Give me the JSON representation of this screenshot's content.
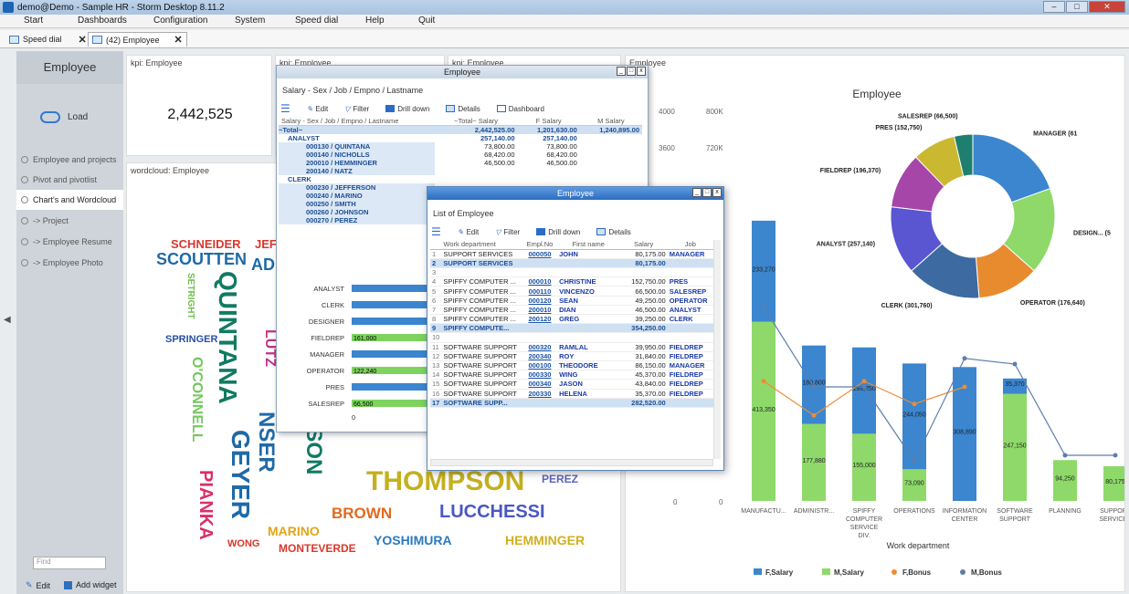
{
  "app": {
    "title": "demo@Demo - Sample HR - Storm Desktop 8.11.2"
  },
  "menu": [
    "Start",
    "Dashboards",
    "Configuration",
    "System",
    "Speed dial",
    "Help",
    "Quit"
  ],
  "tabs": [
    {
      "label": "Speed dial"
    },
    {
      "label": "(42) Employee"
    }
  ],
  "sidebar": {
    "title": "Employee",
    "load": "Load",
    "items": [
      "Employee and projects",
      "Pivot and pivotlist",
      "Chart's and Wordcloud",
      "-> Project",
      "-> Employee Resume",
      "-> Employee Photo"
    ],
    "active_index": 2,
    "find_placeholder": "Find",
    "edit": "Edit",
    "add_widget": "Add widget"
  },
  "kpi": [
    {
      "title": "kpi: Employee",
      "value": "2,442,525"
    },
    {
      "title": "kpi: Employee"
    },
    {
      "title": "kpi: Employee"
    }
  ],
  "wordcloud": {
    "title": "wordcloud: Employee",
    "words": [
      {
        "t": "SCHNEIDER",
        "c": "#d8382c",
        "s": 13
      },
      {
        "t": "JEF",
        "c": "#d8382c",
        "s": 13
      },
      {
        "t": "SCOUTTEN",
        "c": "#1f6aa7",
        "s": 18
      },
      {
        "t": "AD",
        "c": "#1f6aa7",
        "s": 18
      },
      {
        "t": "SETRIGHT",
        "c": "#6cc04a",
        "s": 10,
        "v": true
      },
      {
        "t": "QUINTANA",
        "c": "#127a63",
        "s": 28,
        "v": true
      },
      {
        "t": "SPRINGER",
        "c": "#2a4fa3",
        "s": 11
      },
      {
        "t": "LUTZ",
        "c": "#c53086",
        "s": 16,
        "v": true
      },
      {
        "t": "O'CONNELL",
        "c": "#76c860",
        "s": 16,
        "v": true
      },
      {
        "t": "GEYER",
        "c": "#1f6aa7",
        "s": 28,
        "v": true
      },
      {
        "t": "PIANKA",
        "c": "#d8306b",
        "s": 20,
        "v": true
      },
      {
        "t": "NSER",
        "c": "#1f6aa7",
        "s": 24,
        "v": true
      },
      {
        "t": "RSON",
        "c": "#127a63",
        "s": 24,
        "v": true
      },
      {
        "t": "THOMPSON",
        "c": "#c4b020",
        "s": 30
      },
      {
        "t": "PEREZ",
        "c": "#5a63c2",
        "s": 12
      },
      {
        "t": "BROWN",
        "c": "#e06a1f",
        "s": 17
      },
      {
        "t": "LUCCHESSI",
        "c": "#4a58c2",
        "s": 20
      },
      {
        "t": "MARINO",
        "c": "#e3a415",
        "s": 14
      },
      {
        "t": "WONG",
        "c": "#d8382c",
        "s": 11
      },
      {
        "t": "MONTEVERDE",
        "c": "#d8382c",
        "s": 12
      },
      {
        "t": "YOSHIMURA",
        "c": "#2a7ac0",
        "s": 14
      },
      {
        "t": "HEMMINGER",
        "c": "#d0b020",
        "s": 14
      }
    ]
  },
  "pivot_window": {
    "title": "Employee",
    "subtitle": "Salary - Sex / Job / Empno / Lastname",
    "toolbar": [
      "Edit",
      "Filter",
      "Drill down",
      "Details",
      "Dashboard"
    ],
    "header": [
      "Salary - Sex / Job / Empno / Lastname",
      "~Total~ Salary",
      "F Salary",
      "M Salary"
    ],
    "rows": [
      {
        "label": "~Total~",
        "total": "2,442,525.00",
        "f": "1,201,630.00",
        "m": "1,240,895.00",
        "kind": "tot"
      },
      {
        "label": "ANALYST",
        "total": "257,140.00",
        "f": "257,140.00",
        "m": "",
        "kind": "grp"
      },
      {
        "label": "000130 / QUINTANA",
        "total": "73,800.00",
        "f": "73,800.00",
        "m": "",
        "kind": "row"
      },
      {
        "label": "000140 / NICHOLLS",
        "total": "68,420.00",
        "f": "68,420.00",
        "m": "",
        "kind": "row"
      },
      {
        "label": "200010 / HEMMINGER",
        "total": "46,500.00",
        "f": "46,500.00",
        "m": "",
        "kind": "row"
      },
      {
        "label": "200140 / NATZ",
        "total": "",
        "f": "",
        "m": "",
        "kind": "row"
      },
      {
        "label": "CLERK",
        "total": "",
        "f": "",
        "m": "",
        "kind": "grp"
      },
      {
        "label": "000230 / JEFFERSON",
        "total": "",
        "f": "",
        "m": "",
        "kind": "row"
      },
      {
        "label": "000240 / MARINO",
        "total": "",
        "f": "",
        "m": "",
        "kind": "row"
      },
      {
        "label": "000250 / SMITH",
        "total": "",
        "f": "",
        "m": "",
        "kind": "row"
      },
      {
        "label": "000260 / JOHNSON",
        "total": "",
        "f": "",
        "m": "",
        "kind": "row"
      },
      {
        "label": "000270 / PEREZ",
        "total": "",
        "f": "",
        "m": "",
        "kind": "row"
      }
    ],
    "minichart": {
      "categories": [
        "ANALYST",
        "CLERK",
        "DESIGNER",
        "FIELDREP",
        "MANAGER",
        "OPERATOR",
        "PRES",
        "SALESREP"
      ],
      "blue": [
        "257,140",
        "217,130",
        "341,",
        "",
        "332,8",
        "",
        "152,750",
        ""
      ],
      "green": [
        "",
        "",
        "",
        "161,000",
        "",
        "122,240",
        "",
        "66,500"
      ],
      "blue_v": [
        257140,
        217130,
        341000,
        35000,
        332800,
        15000,
        152750,
        0
      ],
      "green_v": [
        0,
        0,
        0,
        161000,
        0,
        122240,
        0,
        66500
      ],
      "axis": [
        "0",
        "100K"
      ]
    }
  },
  "list_window": {
    "title": "Employee",
    "subtitle": "List of Employee",
    "toolbar": [
      "Edit",
      "Filter",
      "Drill down",
      "Details"
    ],
    "header": [
      "Work department",
      "Empl.No",
      "First name",
      "Salary",
      "Job"
    ],
    "rows": [
      {
        "n": "1",
        "dept": "SUPPORT SERVICES",
        "emp": "000050",
        "fn": "JOHN",
        "sal": "80,175.00",
        "job": "MANAGER",
        "sum": false
      },
      {
        "n": "2",
        "dept": "SUPPORT SERVICES",
        "emp": "",
        "fn": "",
        "sal": "80,175.00",
        "job": "",
        "sum": true
      },
      {
        "n": "3",
        "dept": "",
        "emp": "",
        "fn": "",
        "sal": "",
        "job": "",
        "sum": false
      },
      {
        "n": "4",
        "dept": "SPIFFY COMPUTER ...",
        "emp": "000010",
        "fn": "CHRISTINE",
        "sal": "152,750.00",
        "job": "PRES",
        "sum": false
      },
      {
        "n": "5",
        "dept": "SPIFFY COMPUTER ...",
        "emp": "000110",
        "fn": "VINCENZO",
        "sal": "66,500.00",
        "job": "SALESREP",
        "sum": false
      },
      {
        "n": "6",
        "dept": "SPIFFY COMPUTER ...",
        "emp": "000120",
        "fn": "SEAN",
        "sal": "49,250.00",
        "job": "OPERATOR",
        "sum": false
      },
      {
        "n": "7",
        "dept": "SPIFFY COMPUTER ...",
        "emp": "200010",
        "fn": "DIAN",
        "sal": "46,500.00",
        "job": "ANALYST",
        "sum": false
      },
      {
        "n": "8",
        "dept": "SPIFFY COMPUTER ...",
        "emp": "200120",
        "fn": "GREG",
        "sal": "39,250.00",
        "job": "CLERK",
        "sum": false
      },
      {
        "n": "9",
        "dept": "SPIFFY COMPUTE...",
        "emp": "",
        "fn": "",
        "sal": "354,250.00",
        "job": "",
        "sum": true
      },
      {
        "n": "10",
        "dept": "",
        "emp": "",
        "fn": "",
        "sal": "",
        "job": "",
        "sum": false
      },
      {
        "n": "11",
        "dept": "SOFTWARE SUPPORT",
        "emp": "000320",
        "fn": "RAMLAL",
        "sal": "39,950.00",
        "job": "FIELDREP",
        "sum": false
      },
      {
        "n": "12",
        "dept": "SOFTWARE SUPPORT",
        "emp": "200340",
        "fn": "ROY",
        "sal": "31,840.00",
        "job": "FIELDREP",
        "sum": false
      },
      {
        "n": "13",
        "dept": "SOFTWARE SUPPORT",
        "emp": "000100",
        "fn": "THEODORE",
        "sal": "86,150.00",
        "job": "MANAGER",
        "sum": false
      },
      {
        "n": "14",
        "dept": "SOFTWARE SUPPORT",
        "emp": "000330",
        "fn": "WING",
        "sal": "45,370.00",
        "job": "FIELDREP",
        "sum": false
      },
      {
        "n": "15",
        "dept": "SOFTWARE SUPPORT",
        "emp": "000340",
        "fn": "JASON",
        "sal": "43,840.00",
        "job": "FIELDREP",
        "sum": false
      },
      {
        "n": "16",
        "dept": "SOFTWARE SUPPORT",
        "emp": "200330",
        "fn": "HELENA",
        "sal": "35,370.00",
        "job": "FIELDREP",
        "sum": false
      },
      {
        "n": "17",
        "dept": "SOFTWARE SUPP...",
        "emp": "",
        "fn": "",
        "sal": "282,520.00",
        "job": "",
        "sum": true
      }
    ]
  },
  "chart_panel": {
    "title": "Employee"
  },
  "chart_data": {
    "type": "bar",
    "title": "Employee",
    "xlabel": "Work department",
    "categories": [
      "MANUFACTU...",
      "ADMINISTR...",
      "SPIFFY COMPUTER SERVICE DIV.",
      "OPERATIONS",
      "INFORMATION CENTER",
      "SOFTWARE SUPPORT",
      "PLANNING",
      "SUPPORT SERVICES"
    ],
    "y_left_ticks": [
      "0",
      "3600"
    ],
    "y_right_ticks": [
      "0",
      "720K",
      "800K"
    ],
    "y_left_top": "4000",
    "series": [
      {
        "name": "F,Salary",
        "color": "#3b86cf",
        "values": [
          233270,
          180800,
          199250,
          244050,
          308890,
          35370,
          0,
          0
        ]
      },
      {
        "name": "M,Salary",
        "color": "#8ed96a",
        "values": [
          413350,
          177880,
          155000,
          73090,
          0,
          247150,
          94250,
          80175
        ]
      },
      {
        "name": "F,Bonus",
        "color": "#ee8c35",
        "values": [
          2100,
          1500,
          2100,
          1700,
          2000,
          0,
          0,
          0
        ]
      },
      {
        "name": "M,Bonus",
        "color": "#5b7fae",
        "values": [
          3400,
          2000,
          2000,
          700,
          2500,
          2400,
          800,
          800
        ]
      }
    ],
    "bar_labels_f": [
      "233,270",
      "180,800",
      "199,250",
      "244,050",
      "308,890",
      "35,370",
      "",
      ""
    ],
    "bar_labels_m": [
      "413,350",
      "177,880",
      "155,000",
      "73,090",
      "",
      "247,150",
      "94,250",
      "80,175"
    ],
    "line_labels": [
      "3,400",
      "2,100",
      "2,000",
      "1,500",
      "2,100",
      "2,000",
      "2,200",
      "700",
      "2,500",
      "2,400",
      "800",
      "800"
    ],
    "donut": [
      {
        "label": "MANAGER (61",
        "value": 16,
        "color": "#3b86cf"
      },
      {
        "label": "DESIGN... (5",
        "value": 14,
        "color": "#8ed96a"
      },
      {
        "label": "OPERATOR (176,640)",
        "value": 10,
        "color": "#e88b2e"
      },
      {
        "label": "CLERK (301,760)",
        "value": 12,
        "color": "#3d6aa0"
      },
      {
        "label": "ANALYST (257,140)",
        "value": 11,
        "color": "#5a55d0"
      },
      {
        "label": "FIELDREP (196,370)",
        "value": 9,
        "color": "#a546a8"
      },
      {
        "label": "PRES (152,750)",
        "value": 7,
        "color": "#c9b830"
      },
      {
        "label": "SALESREP (66,500)",
        "value": 3,
        "color": "#1f7f6e"
      }
    ],
    "legend": [
      "F,Salary",
      "M,Salary",
      "F,Bonus",
      "M,Bonus"
    ],
    "legend_position": "bottom"
  }
}
